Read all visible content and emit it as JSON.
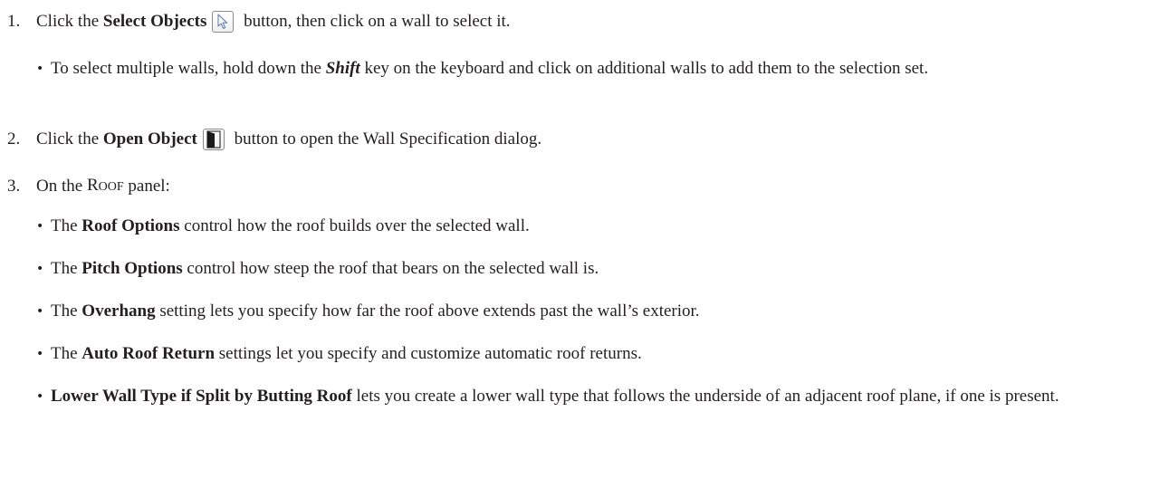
{
  "step1": {
    "number": "1.",
    "pre": "Click the ",
    "bold": "Select Objects",
    "post": " button, then click on a wall to select it.",
    "icon": "select-arrow-icon"
  },
  "bullet_shift": {
    "pre": "To select multiple walls, hold down the ",
    "key": "Shift",
    "post": " key on the keyboard and click on additional walls to add them to the selection set."
  },
  "step2": {
    "number": "2.",
    "pre": "Click the ",
    "bold": "Open Object",
    "post": " button to open the Wall Specification dialog.",
    "icon": "open-object-icon"
  },
  "step3": {
    "number": "3.",
    "pre": "On the ",
    "panel_first": "R",
    "panel_rest": "OOF",
    "post": " panel:"
  },
  "bullets": [
    {
      "pre": "The ",
      "bold": "Roof Options",
      "post": " control how the roof builds over the selected wall."
    },
    {
      "pre": "The ",
      "bold": "Pitch Options",
      "post": " control how steep the roof that bears on the selected wall is."
    },
    {
      "pre": "The ",
      "bold": "Overhang",
      "post": " setting lets you specify how far the roof above extends past the wall’s exterior."
    },
    {
      "pre": "The ",
      "bold": "Auto Roof Return",
      "post": " settings let you specify and customize automatic roof returns."
    },
    {
      "pre": "",
      "bold": "Lower Wall Type if Split by Butting Roof",
      "post": " lets you create a lower wall type that follows the underside of an adjacent roof plane, if one is present."
    }
  ],
  "colors": {
    "text": "#231f20",
    "icon_border": "#8a8a8a",
    "open_icon_fill": "#1a1a1a"
  }
}
